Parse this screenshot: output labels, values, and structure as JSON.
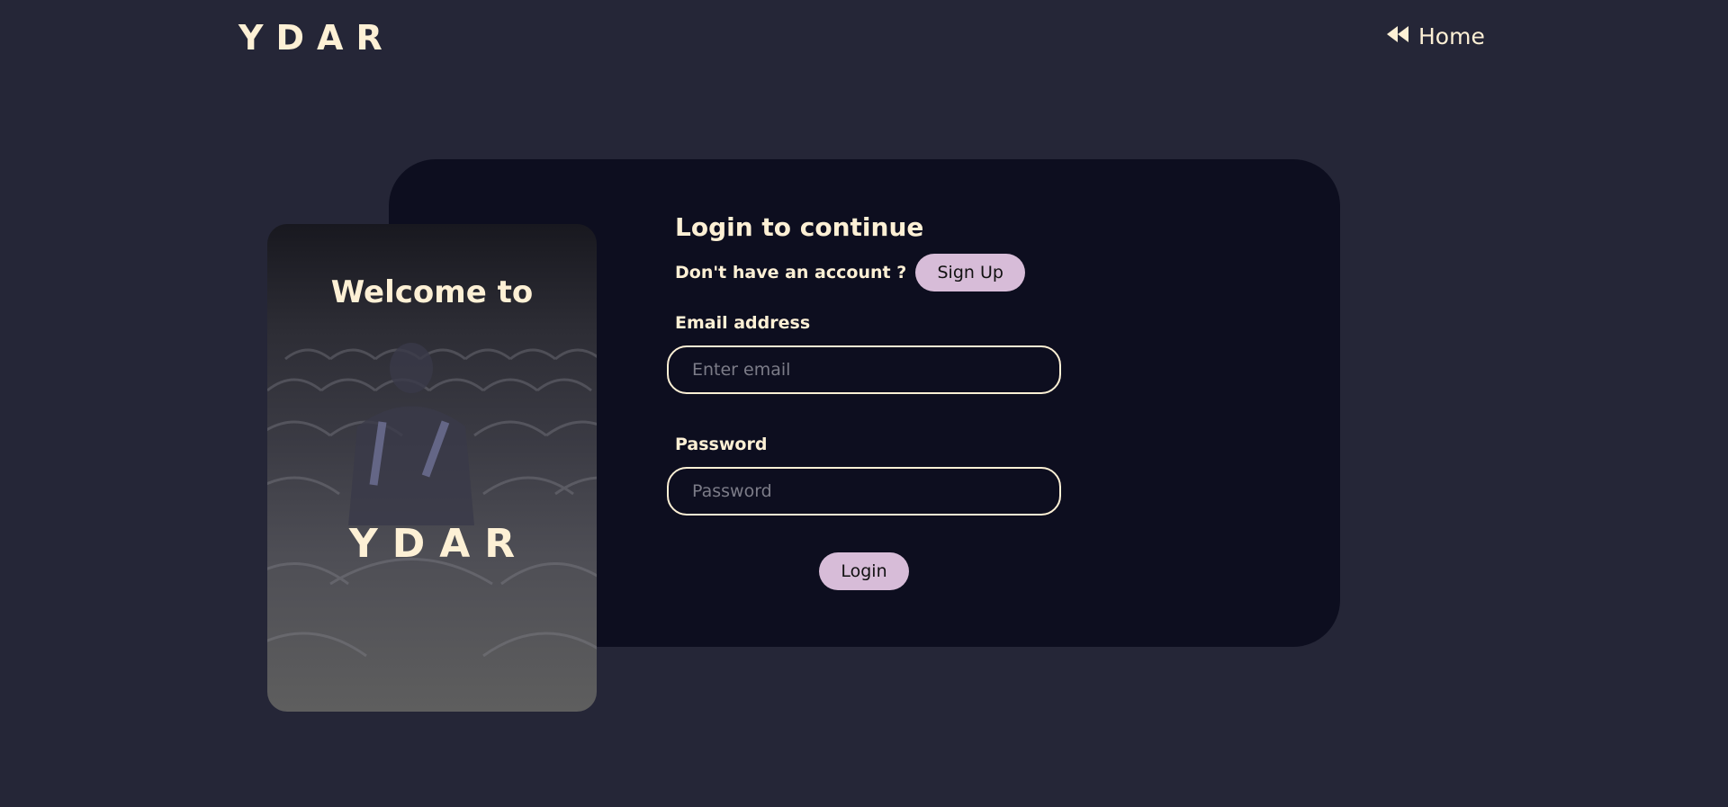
{
  "header": {
    "logo": "YDAR",
    "home_label": "Home",
    "home_icon": "rewind-icon"
  },
  "welcome_card": {
    "title": "Welcome to",
    "brand": "YDAR"
  },
  "form": {
    "title": "Login to continue",
    "no_account_text": "Don't have an account ?",
    "signup_label": "Sign Up",
    "email_label": "Email address",
    "email_placeholder": "Enter email",
    "email_value": "",
    "password_label": "Password",
    "password_placeholder": "Password",
    "password_value": "",
    "login_label": "Login"
  },
  "colors": {
    "background": "#252637",
    "card": "#0d0e1f",
    "text": "#fdf0d5",
    "button": "#d7bcd8"
  }
}
